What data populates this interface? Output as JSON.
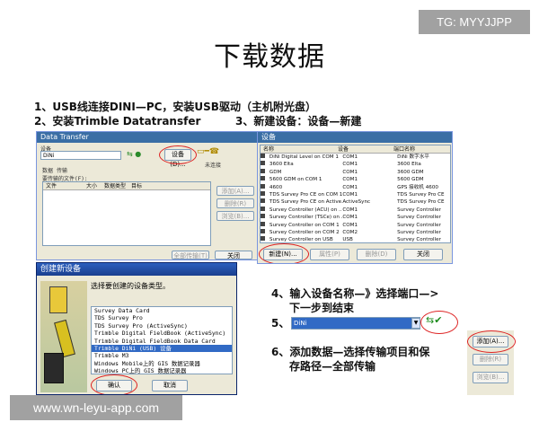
{
  "watermark_top": "TG: MYYJJPP",
  "watermark_bottom": "www.wn-leyu-app.com",
  "title": "下载数据",
  "steps": {
    "s1": "1、USB线连接DINI—PC，安装USB驱动（主机附光盘）",
    "s2": "2、安装Trimble Datatransfer",
    "s3": "3、新建设备：设备—新建",
    "s4a": "4、输入设备名称—》选择端口—>",
    "s4b": "下一步到结束",
    "s5": "5、",
    "s6a": "6、添加数据—选择传输项目和保",
    "s6b": "存路径—全部传输"
  },
  "dt_window": {
    "title": "Data Transfer",
    "device_label": "设备",
    "device_value": "DiNi",
    "device_btn": "设备(D)...",
    "status": "未连接",
    "tabs": [
      "数据",
      "传输"
    ],
    "files_label": "要传输的文件(F):",
    "columns": [
      "文件",
      "大小",
      "数据类型",
      "目标"
    ],
    "side_buttons": [
      "添加(A)...",
      "删除(R)",
      "浏览(B)..."
    ],
    "bottom_buttons": [
      "全部传输(T)",
      "关闭"
    ]
  },
  "device_window": {
    "title": "设备",
    "columns": [
      "名称",
      "设备",
      "端口名称"
    ],
    "rows": [
      [
        "DiNi Digital Level on COM 1",
        "COM1",
        "DiNi 数字水平"
      ],
      [
        "3600 Elta",
        "COM1",
        "3600 Elta"
      ],
      [
        "GDM",
        "COM1",
        "3600 GDM"
      ],
      [
        "5600 GDM on COM 1",
        "COM1",
        "5600 GDM"
      ],
      [
        "4600",
        "COM1",
        "GPS 接收机 4600"
      ],
      [
        "TDS Survey Pro CE on COM 1",
        "COM1",
        "TDS Survey Pro CE"
      ],
      [
        "TDS Survey Pro CE on Active...",
        "ActiveSync",
        "TDS Survey Pro CE"
      ],
      [
        "Survey Controller (ACU) on ...",
        "COM1",
        "Survey Controller"
      ],
      [
        "Survey Controller (TSCe) on ...",
        "COM1",
        "Survey Controller"
      ],
      [
        "Survey Controller on COM 1",
        "COM1",
        "Survey Controller"
      ],
      [
        "Survey Controller on COM 2",
        "COM2",
        "Survey Controller"
      ],
      [
        "Survey Controller on USB",
        "USB",
        "Survey Controller"
      ]
    ],
    "buttons": [
      "新建(N)...",
      "属性(P)",
      "删除(D)",
      "关闭"
    ]
  },
  "new_device_dialog": {
    "title": "创建新设备",
    "prompt": "选择要创建的设备类型。",
    "items": [
      "Survey Data Card",
      "TDS Survey Pro",
      "TDS Survey Pro (ActiveSync)",
      "Trimble Digital FieldBook (ActiveSync)",
      "Trimble Digital FieldBook Data Card",
      "Trimble DiNi (USB) 设备",
      "Trimble M3",
      "Windows Mobile上的 GIS 数据记录器",
      "Windows PC上的 GIS 数据记录器"
    ],
    "selected_index": 5,
    "buttons": [
      "确认",
      "取消"
    ]
  },
  "device_select": {
    "value": "DiNi"
  },
  "add_panel": {
    "buttons": [
      "添加(A)...",
      "删除(R)",
      "浏览(B)..."
    ]
  },
  "colors": {
    "selection": "#316ac5",
    "red_highlight": "#dd2222",
    "title_bar": "#3a6ea5"
  }
}
